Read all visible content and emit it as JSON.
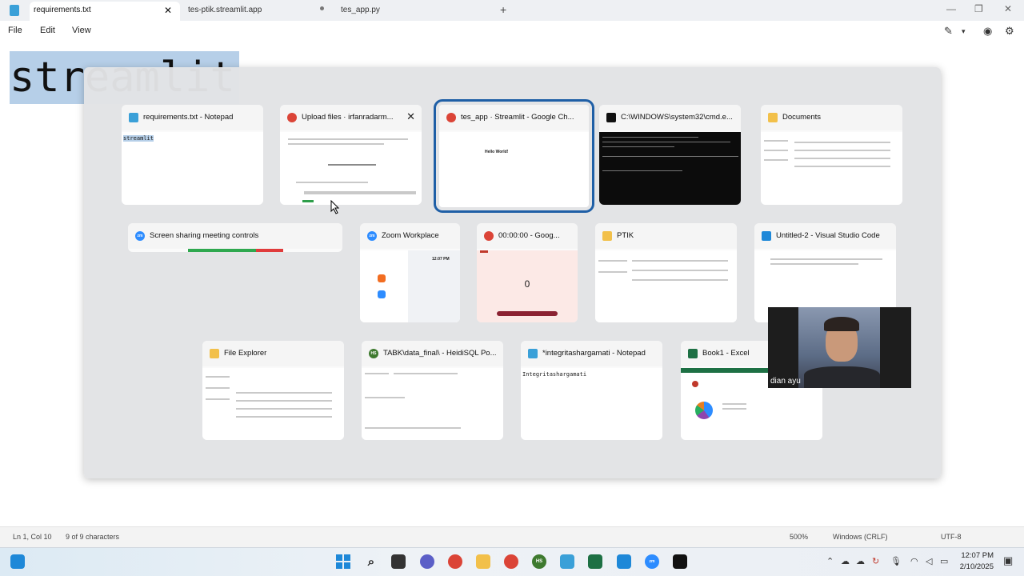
{
  "notepad": {
    "tabs": [
      {
        "label": "requirements.txt"
      },
      {
        "label": "tes-ptik.streamlit.app"
      },
      {
        "label": "tes_app.py"
      }
    ],
    "menu": [
      "File",
      "Edit",
      "View"
    ],
    "editor_text": "streamlit"
  },
  "status": {
    "position": "Ln 1, Col 10",
    "chars": "9 of 9 characters",
    "zoom": "500%",
    "line_ending": "Windows (CRLF)",
    "encoding": "UTF-8"
  },
  "windows": [
    {
      "title": "requirements.txt - Notepad",
      "icon": "notepad-icon",
      "thumb": "streamlit"
    },
    {
      "title": "Upload files · irfanradarm...",
      "icon": "chrome-icon"
    },
    {
      "title": "tes_app · Streamlit - Google Ch...",
      "icon": "chrome-icon",
      "thumb": "Hello World!"
    },
    {
      "title": "C:\\WINDOWS\\system32\\cmd.e...",
      "icon": "cmd-icon"
    },
    {
      "title": "Documents",
      "icon": "folder-icon"
    },
    {
      "title": "Screen sharing meeting controls",
      "icon": "zoom-icon"
    },
    {
      "title": "Zoom Workplace",
      "icon": "zoom-icon",
      "thumb": "12:07 PM"
    },
    {
      "title": "00:00:00 - Goog...",
      "icon": "chrome-icon",
      "thumb": "0"
    },
    {
      "title": "PTIK",
      "icon": "folder-icon"
    },
    {
      "title": "Untitled-2 - Visual Studio Code",
      "icon": "vscode-icon"
    },
    {
      "title": "File Explorer",
      "icon": "folder-icon"
    },
    {
      "title": "TABK\\data_final\\ - HeidiSQL Po...",
      "icon": "heidisql-icon"
    },
    {
      "title": "*integritashargamati - Notepad",
      "icon": "notepad-icon",
      "thumb": "Integritashargamati"
    },
    {
      "title": "Book1 - Excel",
      "icon": "excel-icon"
    }
  ],
  "webcam": {
    "name": "dian ayu"
  },
  "clock": {
    "time": "12:07 PM",
    "date": "2/10/2025"
  },
  "colors": {
    "selection": "#b6cfe8",
    "accent": "#1f5fa6"
  }
}
